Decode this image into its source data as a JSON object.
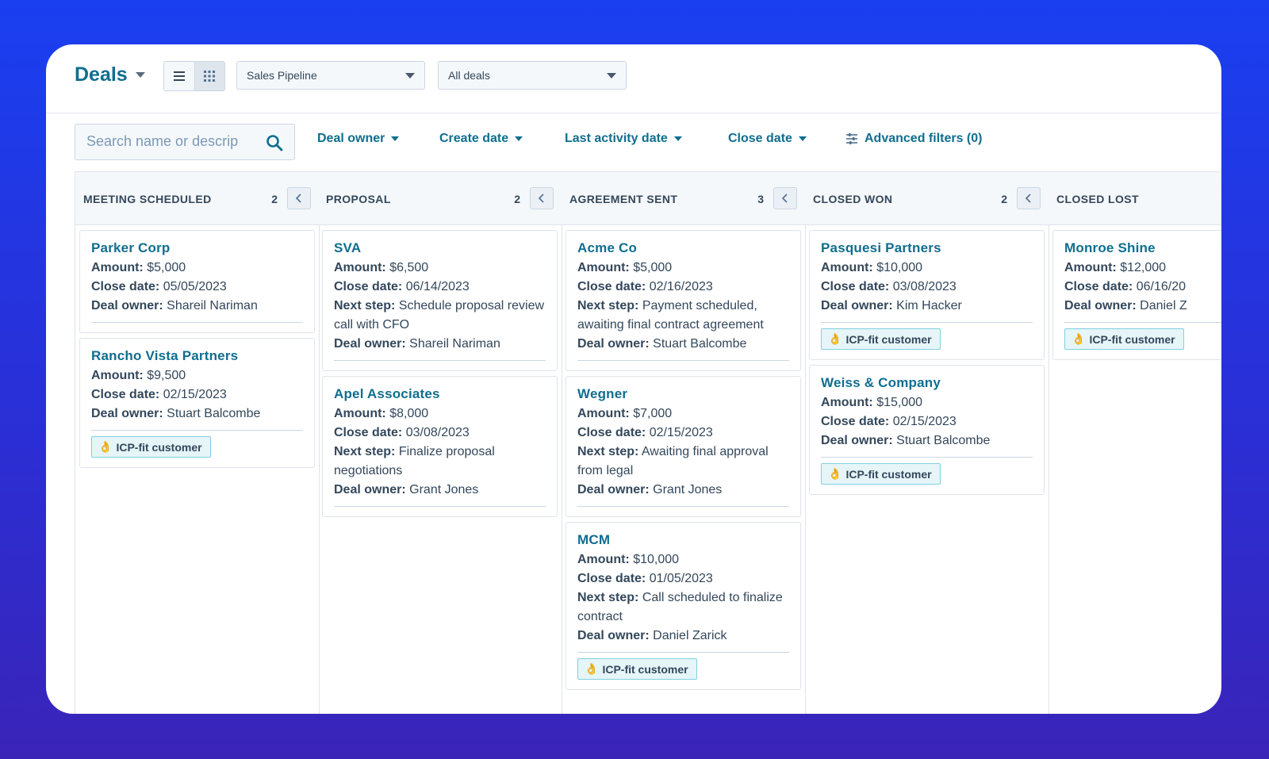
{
  "header": {
    "title": "Deals",
    "pipeline_select": "Sales Pipeline",
    "view_select": "All deals"
  },
  "filters": {
    "search_placeholder": "Search name or descrip",
    "deal_owner": "Deal owner",
    "create_date": "Create date",
    "last_activity_date": "Last activity date",
    "close_date": "Close date",
    "advanced_filters": "Advanced filters (0)"
  },
  "labels": {
    "amount": "Amount:",
    "close_date": "Close date:",
    "next_step": "Next step:",
    "deal_owner": "Deal owner:",
    "icp_tag": "ICP-fit customer"
  },
  "columns": [
    {
      "title": "MEETING SCHEDULED",
      "count": "2",
      "cards": [
        {
          "name": "Parker Corp",
          "amount": "$5,000",
          "close_date": "05/05/2023",
          "deal_owner": "Shareil Nariman"
        },
        {
          "name": "Rancho Vista Partners",
          "amount": "$9,500",
          "close_date": "02/15/2023",
          "deal_owner": "Stuart Balcombe"
        }
      ]
    },
    {
      "title": "PROPOSAL",
      "count": "2",
      "cards": [
        {
          "name": "SVA",
          "amount": "$6,500",
          "close_date": "06/14/2023",
          "next_step": "Schedule proposal review call with CFO",
          "deal_owner": "Shareil Nariman"
        },
        {
          "name": "Apel Associates",
          "amount": "$8,000",
          "close_date": "03/08/2023",
          "next_step": "Finalize proposal negotiations",
          "deal_owner": "Grant Jones"
        }
      ]
    },
    {
      "title": "AGREEMENT SENT",
      "count": "3",
      "cards": [
        {
          "name": "Acme Co",
          "amount": "$5,000",
          "close_date": "02/16/2023",
          "next_step": "Payment scheduled, awaiting final contract agreement",
          "deal_owner": "Stuart Balcombe"
        },
        {
          "name": "Wegner",
          "amount": "$7,000",
          "close_date": "02/15/2023",
          "next_step": "Awaiting final approval from legal",
          "deal_owner": "Grant Jones"
        },
        {
          "name": "MCM",
          "amount": "$10,000",
          "close_date": "01/05/2023",
          "next_step": "Call scheduled to finalize contract",
          "deal_owner": "Daniel Zarick"
        }
      ]
    },
    {
      "title": "CLOSED WON",
      "count": "2",
      "cards": [
        {
          "name": "Pasquesi Partners",
          "amount": "$10,000",
          "close_date": "03/08/2023",
          "deal_owner": "Kim Hacker"
        },
        {
          "name": "Weiss & Company",
          "amount": "$15,000",
          "close_date": "02/15/2023",
          "deal_owner": "Stuart Balcombe"
        }
      ]
    },
    {
      "title": "CLOSED LOST",
      "cards": [
        {
          "name": "Monroe Shine",
          "amount": "$12,000",
          "close_date": "06/16/20",
          "deal_owner": "Daniel Z"
        }
      ]
    }
  ]
}
